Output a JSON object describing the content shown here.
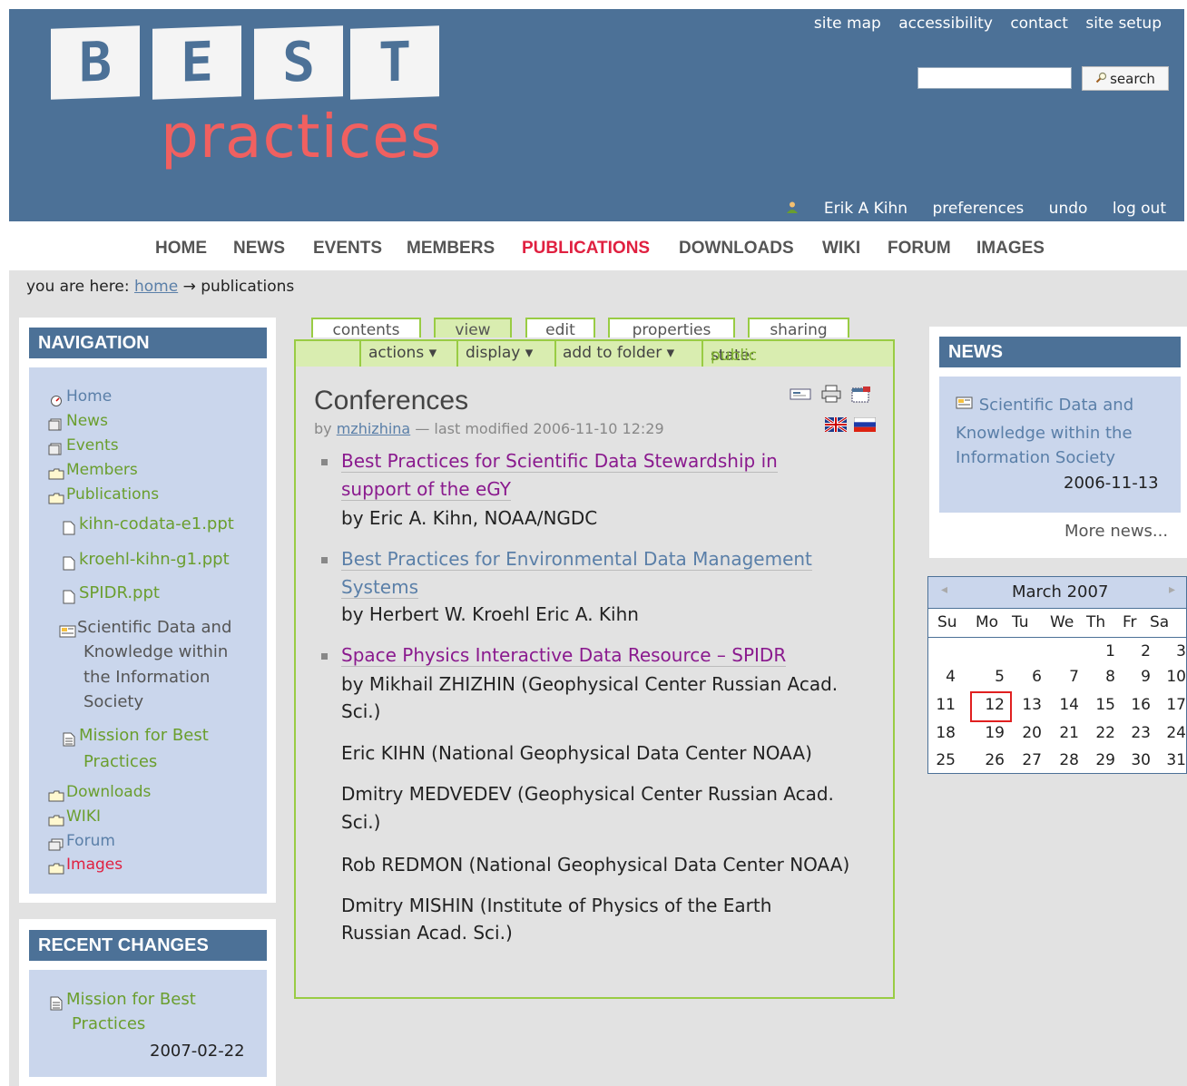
{
  "header": {
    "logo_letters": [
      "B",
      "E",
      "S",
      "T"
    ],
    "logo_word": "practices",
    "site_actions": [
      "site map",
      "accessibility",
      "contact",
      "site setup"
    ],
    "search_button": "search",
    "search_placeholder": "",
    "user": "Erik A Kihn",
    "personal_actions": [
      "preferences",
      "undo",
      "log out"
    ]
  },
  "globalnav": [
    "HOME",
    "NEWS",
    "EVENTS",
    "MEMBERS",
    "PUBLICATIONS",
    "DOWNLOADS",
    "WIKI",
    "FORUM",
    "IMAGES"
  ],
  "breadcrumb": {
    "prefix": "you are here:",
    "home": "home",
    "arrow": "→",
    "current": "publications"
  },
  "navigation": {
    "title": "NAVIGATION",
    "items": [
      "Home",
      "News",
      "Events",
      "Members",
      "Publications",
      "kihn-codata-e1.ppt",
      "kroehl-kihn-g1.ppt",
      "SPIDR.ppt",
      "Scientific Data and",
      "Knowledge within",
      "the Information",
      "Society",
      "Mission for Best",
      "Practices",
      "Downloads",
      "WIKI",
      "Forum",
      "Images"
    ]
  },
  "recent_changes": {
    "title": "RECENT CHANGES",
    "item_line1": "Mission for Best",
    "item_line2": "Practices",
    "date": "2007-02-22"
  },
  "tabs": [
    "contents",
    "view",
    "edit",
    "properties",
    "sharing"
  ],
  "actions": {
    "actions": "actions ▾",
    "display": "display ▾",
    "add_to_folder": "add to folder ▾",
    "state_label": "state:",
    "state_value": "public draft ▾"
  },
  "document": {
    "title": "Conferences",
    "by": "by",
    "author": "mzhizhina",
    "modified": "— last modified 2006-11-10 12:29",
    "entries": [
      {
        "line1": "Best Practices for Scientific Data Stewardship in",
        "line2": "support of the eGY",
        "by": "by Eric A. Kihn, NOAA/NGDC"
      },
      {
        "line1": "Best Practices for Environmental Data Management",
        "line2": "Systems",
        "by": "by Herbert W. Kroehl Eric A. Kihn"
      },
      {
        "line1": "Space Physics Interactive Data Resource – SPIDR",
        "by1": "by Mikhail ZHIZHIN (Geophysical Center Russian Acad.",
        "by2": "Sci.)"
      }
    ],
    "paragraphs": [
      "Eric KIHN (National Geophysical Data Center NOAA)",
      "Dmitry MEDVEDEV (Geophysical Center Russian Acad.",
      "Sci.)",
      "Rob REDMON (National Geophysical Data Center NOAA)",
      "Dmitry MISHIN (Institute of Physics of the Earth",
      "Russian Acad. Sci.)"
    ]
  },
  "news": {
    "title": "NEWS",
    "item": [
      "Scientific Data and",
      "Knowledge within the",
      "Information Society"
    ],
    "date": "2006-11-13",
    "more": "More news..."
  },
  "calendar": {
    "month": "March 2007",
    "prev": "◂",
    "next": "▸",
    "weekdays": [
      "Su",
      "Mo",
      "Tu",
      "We",
      "Th",
      "Fr",
      "Sa"
    ],
    "weeks": [
      [
        "",
        "",
        "",
        "",
        "1",
        "2",
        "3"
      ],
      [
        "4",
        "5",
        "6",
        "7",
        "8",
        "9",
        "10"
      ],
      [
        "11",
        "12",
        "13",
        "14",
        "15",
        "16",
        "17"
      ],
      [
        "18",
        "19",
        "20",
        "21",
        "22",
        "23",
        "24"
      ],
      [
        "25",
        "26",
        "27",
        "28",
        "29",
        "30",
        "31"
      ]
    ],
    "today": "12"
  },
  "colors": {
    "header": "#4c7197",
    "accent_red": "#e02040",
    "nav_green": "#6a9e2e",
    "link_blue": "#5a7fa8",
    "tab_green": "#99cc44"
  }
}
